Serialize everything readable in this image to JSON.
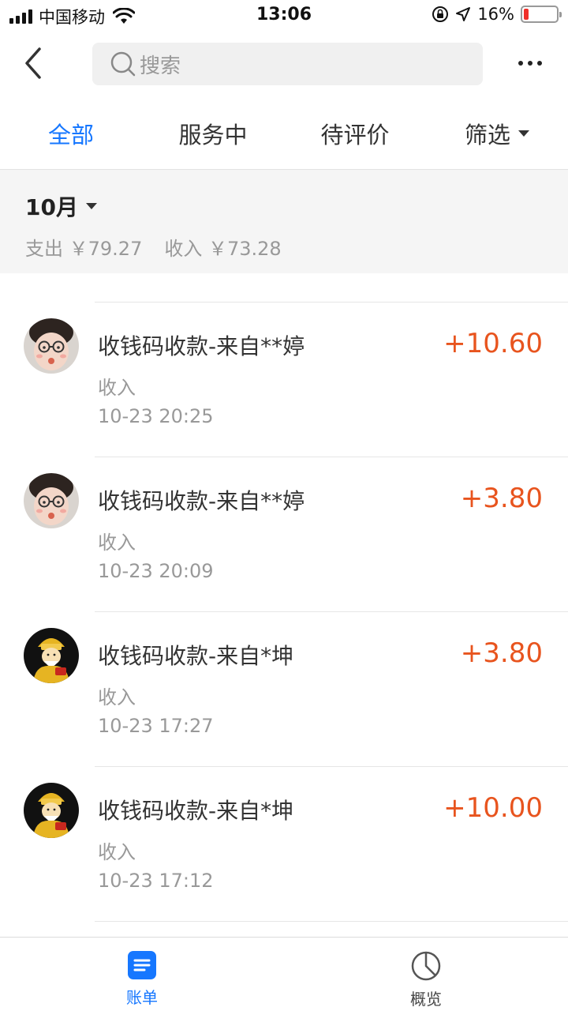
{
  "status_bar": {
    "carrier": "中国移动",
    "time": "13:06",
    "battery_pct": "16%",
    "battery_level": 0.16,
    "icons": [
      "signal-icon",
      "wifi-icon",
      "orientation-lock-icon",
      "location-arrow-icon",
      "battery-icon"
    ]
  },
  "nav": {
    "search_placeholder": "搜索",
    "icons": [
      "back-chevron-icon",
      "search-icon",
      "more-icon"
    ]
  },
  "tabs": [
    {
      "label": "全部",
      "active": true
    },
    {
      "label": "服务中",
      "active": false
    },
    {
      "label": "待评价",
      "active": false
    },
    {
      "label": "筛选",
      "active": false
    }
  ],
  "summary": {
    "month": "10月",
    "expense": "支出 ￥79.27",
    "income": "收入 ￥73.28"
  },
  "transactions": [
    {
      "title": "收钱码收款-来自**婷",
      "kind": "收入",
      "time": "10-23  20:25",
      "amount": "+10.60",
      "avatar": "child-avatar"
    },
    {
      "title": "收钱码收款-来自**婷",
      "kind": "收入",
      "time": "10-23  20:09",
      "amount": "+3.80",
      "avatar": "child-avatar"
    },
    {
      "title": "收钱码收款-来自*坤",
      "kind": "收入",
      "time": "10-23  17:27",
      "amount": "+3.80",
      "avatar": "fortune-god-avatar"
    },
    {
      "title": "收钱码收款-来自*坤",
      "kind": "收入",
      "time": "10-23  17:12",
      "amount": "+10.00",
      "avatar": "fortune-god-avatar"
    }
  ],
  "bottom_nav": [
    {
      "label": "账单",
      "icon": "bill-icon",
      "active": true
    },
    {
      "label": "概览",
      "icon": "pie-chart-icon",
      "active": false
    }
  ],
  "colors": {
    "accent": "#1677ff",
    "amount": "#e8541e",
    "panel_bg": "#f5f5f5",
    "secondary_text": "#999999"
  }
}
